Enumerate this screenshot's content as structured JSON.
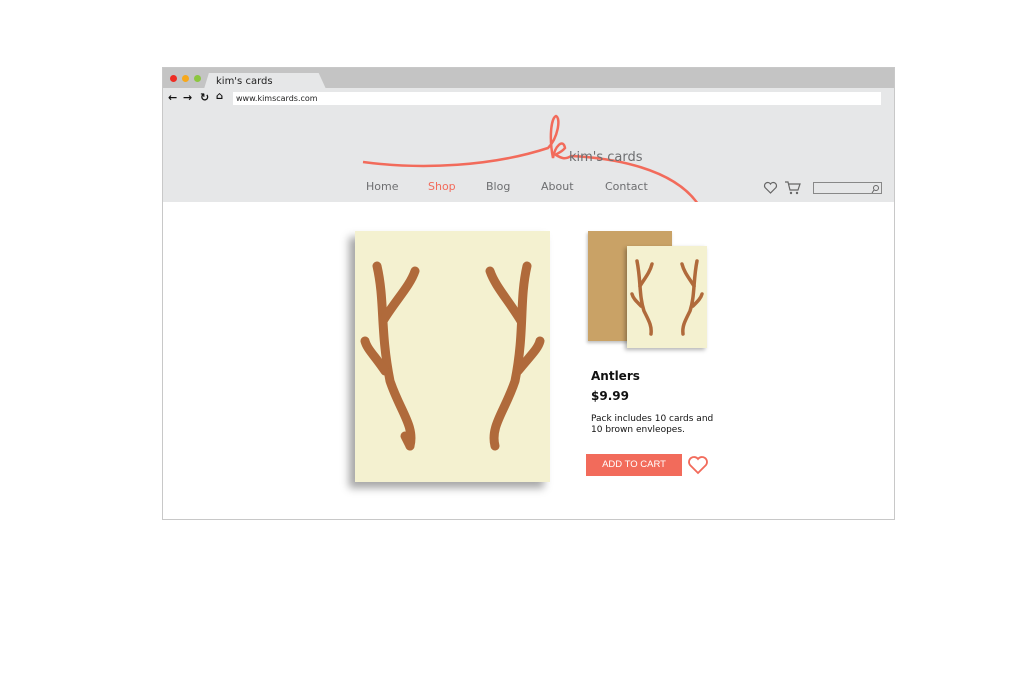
{
  "browser": {
    "tab_title": "kim's cards",
    "url": "www.kimscards.com",
    "nav_icons": [
      "back-arrow-icon",
      "forward-arrow-icon",
      "reload-icon",
      "home-icon"
    ],
    "dots": [
      "#ee2d24",
      "#f7a81b",
      "#8cc63f"
    ]
  },
  "site": {
    "logo_text": "kim's cards",
    "logo_letter": "k",
    "accent": "#f26b5b",
    "nav": [
      {
        "label": "Home"
      },
      {
        "label": "Shop",
        "active": true
      },
      {
        "label": "Blog"
      },
      {
        "label": "About"
      },
      {
        "label": "Contact"
      }
    ],
    "icons": [
      "heart-icon",
      "cart-icon",
      "search-icon"
    ]
  },
  "product": {
    "title": "Antlers",
    "price": "$9.99",
    "description": "Pack includes 10 cards and 10 brown envleopes.",
    "add_to_cart": "ADD TO CART",
    "card_color": "#f4f1d0",
    "envelope_color": "#c9a266",
    "ink_color": "#b06a3b"
  }
}
